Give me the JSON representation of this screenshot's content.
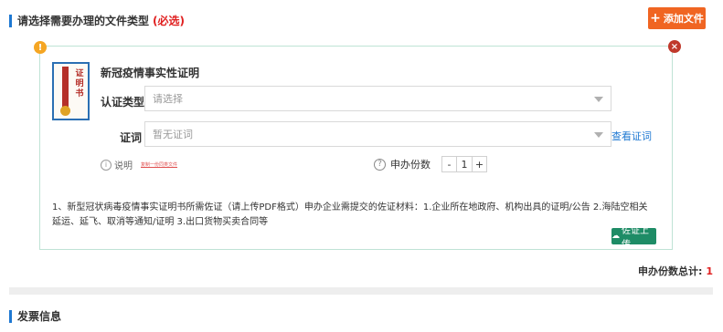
{
  "file_section": {
    "title": "请选择需要办理的文件类型",
    "required": "(必选)",
    "add_button": "添加文件"
  },
  "badges": {
    "info": "!",
    "close": "×"
  },
  "certificate": {
    "icon_chars": "证明书",
    "title": "新冠疫情事实性证明",
    "cert_type_label": "认证类型",
    "cert_type_placeholder": "请选择",
    "evidence_label": "证词",
    "evidence_placeholder": "暂无证词",
    "view_evidence_link": "查看证词",
    "help_label": "说明",
    "help_link": "复制一份同类文件",
    "count_label": "申办份数",
    "minus": "-",
    "count_value": "1",
    "plus": "+",
    "description": "1、新型冠状病毒疫情事实证明书所需佐证（请上传PDF格式）申办企业需提交的佐证材料：1.企业所在地政府、机构出具的证明/公告 2.海陆空相关延运、延飞、取消等通知/证明 3.出口货物买卖合同等",
    "upload_button": "佐证上传"
  },
  "summary": {
    "total_label": "申办份数总计:",
    "total_value": "1"
  },
  "invoice_section": {
    "title": "发票信息"
  },
  "colors": {
    "accent": "#1e78d2",
    "orange": "#f06522",
    "green": "#1e8c66",
    "red": "#e02020"
  },
  "icons": [
    "plus-icon",
    "info-icon",
    "close-icon",
    "certificate-icon",
    "dropdown-caret-icon",
    "help-circle-icon",
    "question-icon",
    "cloud-upload-icon"
  ]
}
